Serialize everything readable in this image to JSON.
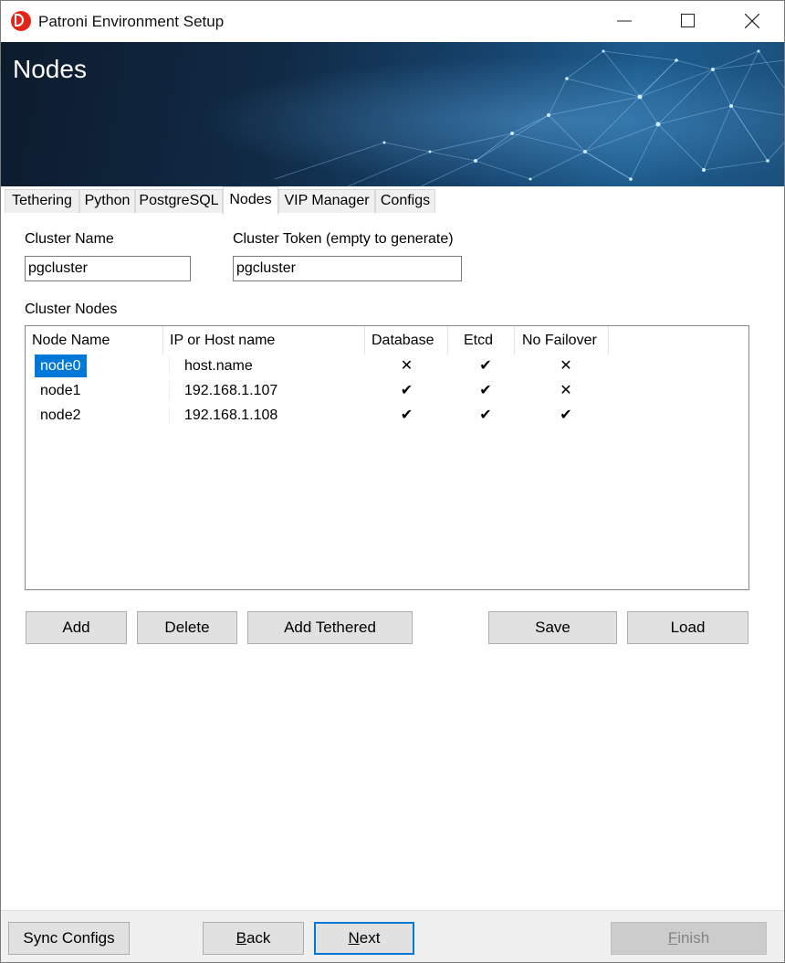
{
  "window": {
    "title": "Patroni Environment Setup"
  },
  "banner": {
    "title": "Nodes"
  },
  "tabs": [
    {
      "label": "Tethering",
      "active": false
    },
    {
      "label": "Python",
      "active": false
    },
    {
      "label": "PostgreSQL",
      "active": false
    },
    {
      "label": "Nodes",
      "active": true
    },
    {
      "label": "VIP Manager",
      "active": false
    },
    {
      "label": "Configs",
      "active": false
    }
  ],
  "form": {
    "cluster_name_label": "Cluster Name",
    "cluster_name_value": "pgcluster",
    "cluster_token_label": "Cluster Token (empty to generate)",
    "cluster_token_value": "pgcluster",
    "cluster_nodes_label": "Cluster Nodes"
  },
  "nodes_table": {
    "columns": [
      "Node Name",
      "IP or Host name",
      "Database",
      "Etcd",
      "No Failover"
    ],
    "rows": [
      {
        "name": "node0",
        "host": "host.name",
        "database": "✕",
        "etcd": "✔",
        "no_failover": "✕",
        "selected": true
      },
      {
        "name": "node1",
        "host": "192.168.1.107",
        "database": "✔",
        "etcd": "✔",
        "no_failover": "✕",
        "selected": false
      },
      {
        "name": "node2",
        "host": "192.168.1.108",
        "database": "✔",
        "etcd": "✔",
        "no_failover": "✔",
        "selected": false
      }
    ]
  },
  "actions": {
    "add": "Add",
    "delete": "Delete",
    "add_tethered": "Add Tethered",
    "save": "Save",
    "load": "Load"
  },
  "footer": {
    "sync_configs": "Sync Configs",
    "back": {
      "prefix": "",
      "mnemonic": "B",
      "rest": "ack"
    },
    "next": {
      "prefix": "",
      "mnemonic": "N",
      "rest": "ext"
    },
    "finish": {
      "prefix": "",
      "mnemonic": "F",
      "rest": "inish"
    }
  },
  "colors": {
    "accent": "#0078d7",
    "app_icon": "#e1251b",
    "banner_dark": "#0d1b2d",
    "banner_light": "#1d5c8d"
  },
  "icons": {
    "app": "patroni-d-logo",
    "minimize": "minimize-icon",
    "maximize": "maximize-icon",
    "close": "close-icon"
  }
}
